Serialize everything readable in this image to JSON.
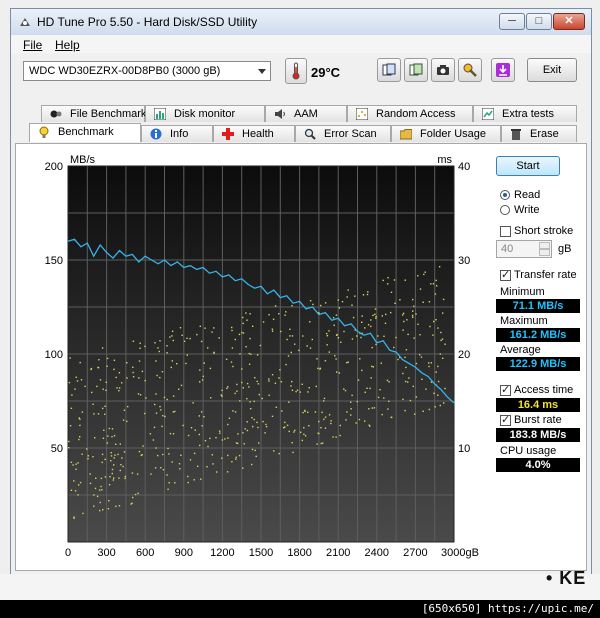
{
  "window": {
    "title": "HD Tune Pro 5.50 - Hard Disk/SSD Utility",
    "min_glyph": "─",
    "max_glyph": "□",
    "close_glyph": "✕"
  },
  "menu": {
    "file": "File",
    "help": "Help"
  },
  "toolbar": {
    "drive": "WDC WD30EZRX-00D8PB0 (3000 gB)",
    "temperature": "29°C",
    "exit_label": "Exit"
  },
  "tabs_top": [
    {
      "label": "File Benchmark",
      "icon": "file-benchmark-icon"
    },
    {
      "label": "Disk monitor",
      "icon": "disk-monitor-icon"
    },
    {
      "label": "AAM",
      "icon": "speaker-icon"
    },
    {
      "label": "Random Access",
      "icon": "random-access-icon"
    },
    {
      "label": "Extra tests",
      "icon": "extra-tests-icon"
    }
  ],
  "tabs_bottom": [
    {
      "label": "Benchmark",
      "icon": "benchmark-icon"
    },
    {
      "label": "Info",
      "icon": "info-icon"
    },
    {
      "label": "Health",
      "icon": "health-cross-icon"
    },
    {
      "label": "Error Scan",
      "icon": "magnifier-icon"
    },
    {
      "label": "Folder Usage",
      "icon": "folder-icon"
    },
    {
      "label": "Erase",
      "icon": "trash-icon"
    }
  ],
  "side": {
    "start_label": "Start",
    "read_label": "Read",
    "write_label": "Write",
    "short_stroke_label": "Short stroke",
    "short_stroke_value": "40",
    "short_stroke_unit": "gB",
    "transfer_rate_label": "Transfer rate",
    "minimum_label": "Minimum",
    "minimum_value": "71.1 MB/s",
    "maximum_label": "Maximum",
    "maximum_value": "161.2 MB/s",
    "average_label": "Average",
    "average_value": "122.9 MB/s",
    "access_time_label": "Access time",
    "access_time_value": "16.4 ms",
    "burst_rate_label": "Burst rate",
    "burst_rate_value": "183.8 MB/s",
    "cpu_usage_label": "CPU usage",
    "cpu_usage_value": "4.0%"
  },
  "colors": {
    "transfer_line": "#35b4ec",
    "access_dots": "#d8d45a",
    "plot_bg_top": "#0c0c0c",
    "plot_bg_bottom": "#4a4a4a"
  },
  "chart_data": {
    "type": "line",
    "left_unit": "MB/s",
    "right_unit": "ms",
    "ylim_left": [
      0,
      200
    ],
    "ylim_right": [
      0,
      40
    ],
    "xlim": [
      0,
      3000
    ],
    "left_ticks": [
      "200",
      "150",
      "100",
      "50"
    ],
    "right_ticks": [
      "40",
      "30",
      "20",
      "10"
    ],
    "x_ticks": [
      "0",
      "300",
      "600",
      "900",
      "1200",
      "1500",
      "1800",
      "2100",
      "2400",
      "2700",
      "3000gB"
    ],
    "grid": true,
    "series": [
      {
        "x": [
          0,
          50,
          100,
          150,
          200,
          250,
          300,
          350,
          400,
          450,
          500,
          550,
          600,
          650,
          700,
          750,
          800,
          850,
          900,
          950,
          1000,
          1050,
          1100,
          1150,
          1200,
          1250,
          1300,
          1350,
          1400,
          1450,
          1500,
          1550,
          1600,
          1650,
          1700,
          1750,
          1800,
          1850,
          1900,
          1950,
          2000,
          2050,
          2100,
          2150,
          2200,
          2250,
          2300,
          2350,
          2400,
          2450,
          2500,
          2550,
          2600,
          2650,
          2700,
          2750,
          2800,
          2850,
          2900,
          2950,
          3000
        ],
        "values": [
          160,
          161,
          157,
          159,
          152,
          158,
          154,
          151,
          155,
          152,
          153,
          149,
          152,
          150,
          148,
          150,
          147,
          149,
          146,
          147,
          145,
          146,
          143,
          144,
          141,
          142,
          139,
          140,
          137,
          135,
          136,
          132,
          134,
          130,
          131,
          127,
          128,
          124,
          125,
          121,
          122,
          118,
          119,
          115,
          116,
          112,
          110,
          111,
          106,
          107,
          102,
          101,
          97,
          95,
          93,
          90,
          88,
          84,
          81,
          77,
          74
        ]
      }
    ],
    "access_time_cloud": {
      "x_range": [
        0,
        2950
      ],
      "ms_min_at_start": 2,
      "ms_max_at_start": 20,
      "ms_min_at_end": 15,
      "ms_max_at_end": 30
    }
  }
}
